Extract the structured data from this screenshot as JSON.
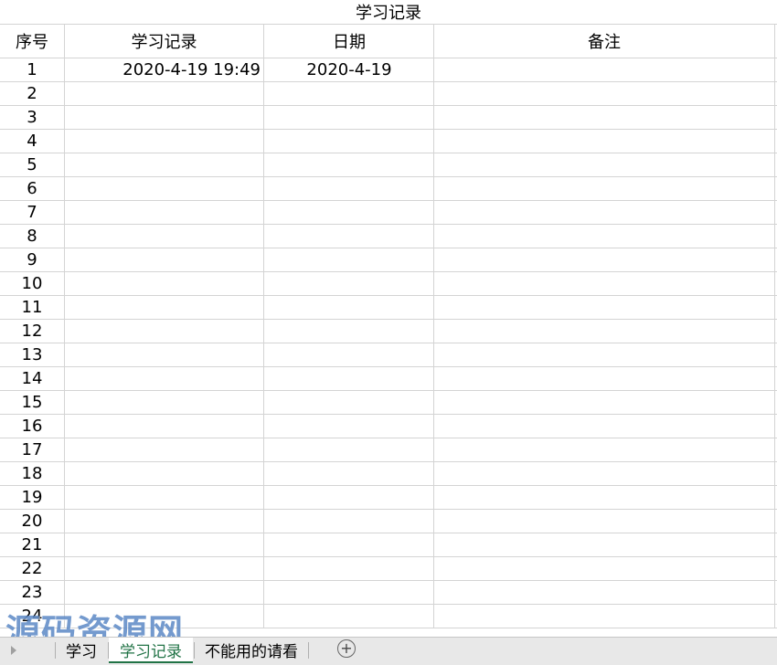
{
  "sheet": {
    "title": "学习记录",
    "headers": {
      "index": "序号",
      "record": "学习记录",
      "date": "日期",
      "note": "备注"
    },
    "rows": [
      {
        "index": "1",
        "record": "2020-4-19 19:49",
        "date": "2020-4-19",
        "note": ""
      },
      {
        "index": "2",
        "record": "",
        "date": "",
        "note": ""
      },
      {
        "index": "3",
        "record": "",
        "date": "",
        "note": ""
      },
      {
        "index": "4",
        "record": "",
        "date": "",
        "note": ""
      },
      {
        "index": "5",
        "record": "",
        "date": "",
        "note": ""
      },
      {
        "index": "6",
        "record": "",
        "date": "",
        "note": ""
      },
      {
        "index": "7",
        "record": "",
        "date": "",
        "note": ""
      },
      {
        "index": "8",
        "record": "",
        "date": "",
        "note": ""
      },
      {
        "index": "9",
        "record": "",
        "date": "",
        "note": ""
      },
      {
        "index": "10",
        "record": "",
        "date": "",
        "note": ""
      },
      {
        "index": "11",
        "record": "",
        "date": "",
        "note": ""
      },
      {
        "index": "12",
        "record": "",
        "date": "",
        "note": ""
      },
      {
        "index": "13",
        "record": "",
        "date": "",
        "note": ""
      },
      {
        "index": "14",
        "record": "",
        "date": "",
        "note": ""
      },
      {
        "index": "15",
        "record": "",
        "date": "",
        "note": ""
      },
      {
        "index": "16",
        "record": "",
        "date": "",
        "note": ""
      },
      {
        "index": "17",
        "record": "",
        "date": "",
        "note": ""
      },
      {
        "index": "18",
        "record": "",
        "date": "",
        "note": ""
      },
      {
        "index": "19",
        "record": "",
        "date": "",
        "note": ""
      },
      {
        "index": "20",
        "record": "",
        "date": "",
        "note": ""
      },
      {
        "index": "21",
        "record": "",
        "date": "",
        "note": ""
      },
      {
        "index": "22",
        "record": "",
        "date": "",
        "note": ""
      },
      {
        "index": "23",
        "record": "",
        "date": "",
        "note": ""
      },
      {
        "index": "24",
        "record": "",
        "date": "",
        "note": ""
      }
    ]
  },
  "tabs": [
    {
      "label": "学习",
      "active": false
    },
    {
      "label": "学习记录",
      "active": true
    },
    {
      "label": "不能用的请看",
      "active": false
    }
  ],
  "add_sheet_icon": "plus-circle-icon",
  "watermark": {
    "text": "源码资源网",
    "url": "http://www.net188.com"
  },
  "colors": {
    "grid": "#d4d4d4",
    "active_tab": "#217346",
    "tabbar_bg": "#e8e8e8"
  }
}
